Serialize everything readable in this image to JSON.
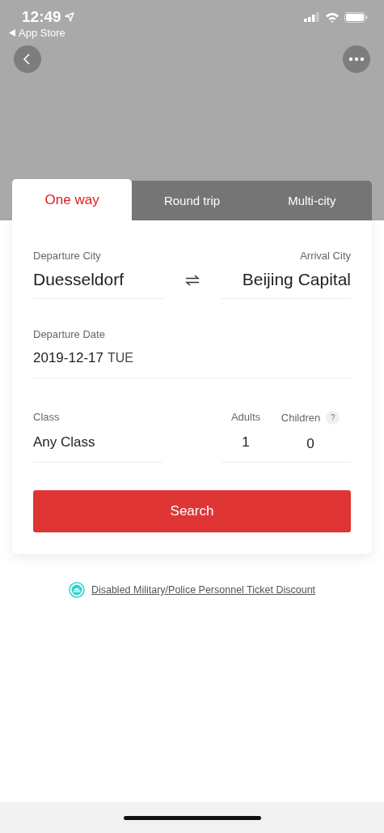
{
  "status_bar": {
    "time": "12:49",
    "back_app": "App Store"
  },
  "tabs": [
    {
      "label": "One way",
      "selected": true
    },
    {
      "label": "Round trip",
      "selected": false
    },
    {
      "label": "Multi-city",
      "selected": false
    }
  ],
  "route": {
    "departure_label": "Departure City",
    "departure": "Duesseldorf",
    "arrival_label": "Arrival City",
    "arrival": "Beijing Capital"
  },
  "date": {
    "label": "Departure Date",
    "value": "2019-12-17",
    "weekday": "TUE"
  },
  "passengers": {
    "class_label": "Class",
    "class_value": "Any Class",
    "adults_label": "Adults",
    "adults": "1",
    "children_label": "Children",
    "children_help": "?",
    "children": "0"
  },
  "search_button": "Search",
  "discount_link": "Disabled Military/Police Personnel Ticket Discount"
}
